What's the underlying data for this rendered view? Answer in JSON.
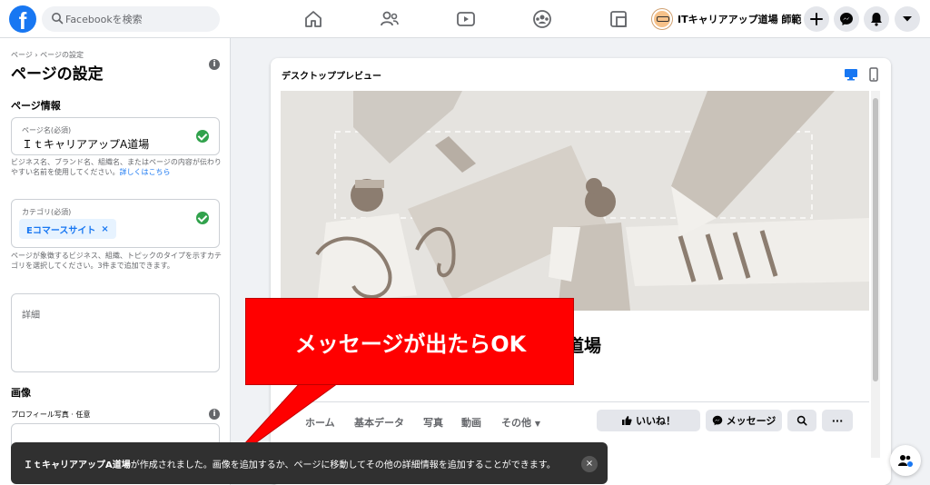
{
  "topbar": {
    "logo": "f",
    "search_placeholder": "Facebookを検索",
    "profile_name": "ITキャリアアップ道場 師範",
    "icons": [
      "home-icon",
      "friends-icon",
      "watch-icon",
      "groups-icon",
      "gaming-icon",
      "plus-icon",
      "messenger-icon",
      "notifications-icon",
      "account-menu-icon"
    ]
  },
  "sidebar": {
    "breadcrumb": "ページ › ページの設定",
    "title": "ページの設定",
    "page_info_heading": "ページ情報",
    "page_name": {
      "label": "ページ名(必須)",
      "value": "ＩｔキャリアアップA道場"
    },
    "page_name_help": "ビジネス名、ブランド名、組織名、またはページの内容が伝わりやすい名前を使用してください。",
    "learn_more": "詳しくはこちら",
    "category": {
      "label": "カテゴリ(必須)",
      "chip": "Eコマースサイト",
      "chip_remove": "×"
    },
    "category_help": "ページが象徴するビジネス、組織、トピックのタイプを示すカテゴリを選択してください。3件まで追加できます。",
    "details_placeholder": "詳細",
    "image_heading": "画像",
    "profile_photo_label": "プロフィール写真 · 任意"
  },
  "preview": {
    "title": "デスクトッププレビュー",
    "page_name_partial": "道場",
    "tabs": [
      "ホーム",
      "基本データ",
      "写真",
      "動画",
      "その他"
    ],
    "like_button": "いいね！",
    "message_button": "メッセージ",
    "search_icon": "search-icon",
    "more_button": "···"
  },
  "callout": {
    "text": "メッセージが出たらOK"
  },
  "toast": {
    "page_name": "ＩｔキャリアアップA道場",
    "message": "が作成されました。画像を追加するか、ページに移動してその他の詳細情報を追加することができます。",
    "close": "×"
  },
  "colors": {
    "brand": "#1877f2",
    "callout": "#ff0000",
    "success": "#31a24c",
    "toast_bg": "#303030"
  }
}
